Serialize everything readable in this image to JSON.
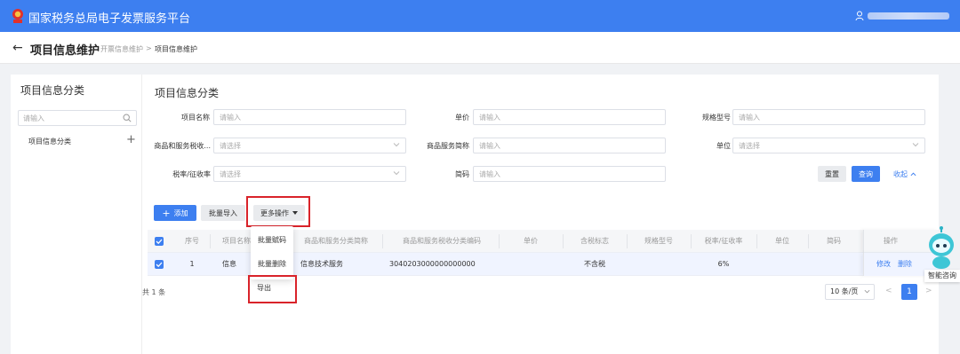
{
  "header": {
    "app_title": "国家税务总局电子发票服务平台"
  },
  "breadcrumb": {
    "page_title": "项目信息维护",
    "parent": "开票信息维护",
    "separator": ">",
    "current": "项目信息维护"
  },
  "left_panel": {
    "title": "项目信息分类",
    "search_placeholder": "请输入",
    "tree_item": "项目信息分类",
    "add_symbol": "+"
  },
  "main": {
    "title": "项目信息分类",
    "filters": [
      {
        "label": "项目名称",
        "placeholder": "请输入"
      },
      {
        "label": "单价",
        "placeholder": "请输入"
      },
      {
        "label": "规格型号",
        "placeholder": "请输入"
      },
      {
        "label": "商品和服务税收...",
        "placeholder": "请选择"
      },
      {
        "label": "商品服务简称",
        "placeholder": "请输入"
      },
      {
        "label": "单位",
        "placeholder": "请选择"
      },
      {
        "label": "税率/征收率",
        "placeholder": "请选择"
      },
      {
        "label": "简码",
        "placeholder": "请输入"
      }
    ],
    "reset_label": "重置",
    "query_label": "查询",
    "collapse_label": "收起"
  },
  "toolbar": {
    "add_label": "添加",
    "add_symbol": "+",
    "batch_import_label": "批量导入",
    "more_label": "更多操作"
  },
  "more_menu": [
    "批量赋码",
    "批量删除",
    "导出"
  ],
  "table": {
    "columns": [
      "序号",
      "项目名称",
      "商品和服务分类简称",
      "商品和服务税收分类编码",
      "单价",
      "含税标志",
      "规格型号",
      "税率/征收率",
      "单位",
      "简码",
      "操作"
    ],
    "rows": [
      {
        "index": "1",
        "name": "信息",
        "category": "信息技术服务",
        "code": "3040203000000000000",
        "price": "",
        "tax_flag": "不含税",
        "spec": "",
        "rate": "6%",
        "unit": "",
        "short_code": "",
        "edit": "修改",
        "delete": "删除"
      }
    ]
  },
  "pagination": {
    "total": "共 1 条",
    "page_size": "10 条/页",
    "prev": "<",
    "current_page": "1",
    "next": ">"
  },
  "assistant": {
    "label": "智能咨询"
  },
  "colors": {
    "primary": "#3d7ff0",
    "highlight_frame": "#d9232a"
  }
}
